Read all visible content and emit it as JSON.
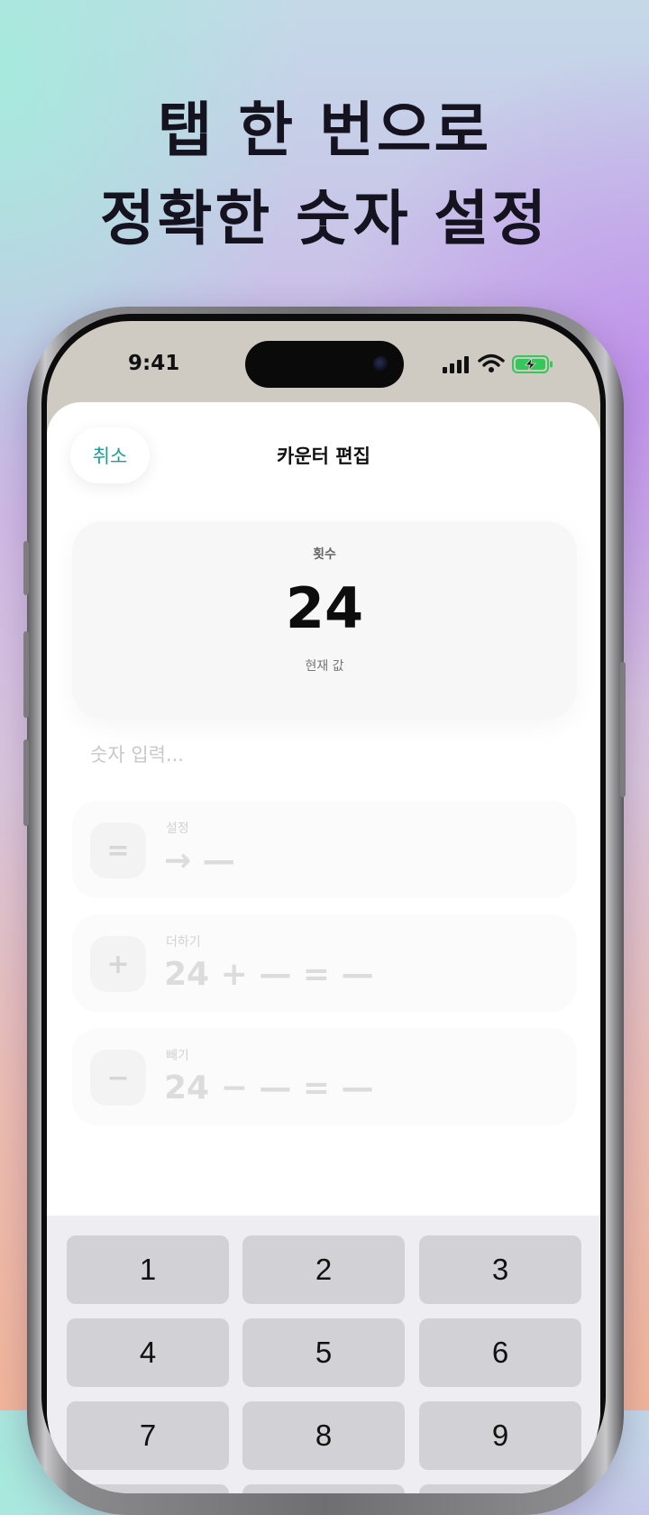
{
  "headline": {
    "line1": "탭 한 번으로",
    "line2": "정확한 숫자 설정"
  },
  "status_bar": {
    "time": "9:41",
    "icons": [
      "signal-icon",
      "wifi-icon",
      "battery-charging-icon"
    ],
    "battery_color": "#34c759"
  },
  "nav": {
    "cancel_label": "취소",
    "title": "카운터 편집"
  },
  "counter": {
    "label": "횟수",
    "value": "24",
    "subtitle": "현재 값"
  },
  "input": {
    "placeholder": "숫자 입력..."
  },
  "operations": [
    {
      "symbol": "=",
      "label": "설정",
      "expression": "→ —"
    },
    {
      "symbol": "+",
      "label": "더하기",
      "expression": "24 + — = —"
    },
    {
      "symbol": "−",
      "label": "빼기",
      "expression": "24 − — = —"
    }
  ],
  "keypad": {
    "keys": [
      "1",
      "2",
      "3",
      "4",
      "5",
      "6",
      "7",
      "8",
      "9"
    ]
  },
  "colors": {
    "accent": "#1b9e96",
    "key_bg": "#d2d2d6",
    "keypad_bg": "#eeeef2"
  }
}
